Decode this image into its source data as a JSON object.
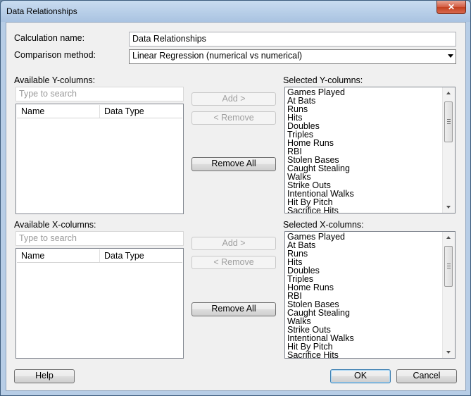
{
  "window": {
    "title": "Data Relationships",
    "close_glyph": "✕"
  },
  "calculation": {
    "label": "Calculation name:",
    "value": "Data Relationships"
  },
  "comparison": {
    "label": "Comparison method:",
    "value": "Linear Regression (numerical vs numerical)"
  },
  "y_section": {
    "available_label": "Available Y-columns:",
    "search_placeholder": "Type to search",
    "columns": [
      "Name",
      "Data Type"
    ],
    "selected_label": "Selected Y-columns:",
    "add_label": "Add >",
    "remove_label": "< Remove",
    "remove_all_label": "Remove All",
    "selected_items": [
      "Games Played",
      "At Bats",
      "Runs",
      "Hits",
      "Doubles",
      "Triples",
      "Home Runs",
      "RBI",
      "Stolen Bases",
      "Caught Stealing",
      "Walks",
      "Strike Outs",
      "Intentional Walks",
      "Hit By Pitch",
      "Sacrifice Hits"
    ]
  },
  "x_section": {
    "available_label": "Available X-columns:",
    "search_placeholder": "Type to search",
    "columns": [
      "Name",
      "Data Type"
    ],
    "selected_label": "Selected X-columns:",
    "add_label": "Add >",
    "remove_label": "< Remove",
    "remove_all_label": "Remove All",
    "selected_items": [
      "Games Played",
      "At Bats",
      "Runs",
      "Hits",
      "Doubles",
      "Triples",
      "Home Runs",
      "RBI",
      "Stolen Bases",
      "Caught Stealing",
      "Walks",
      "Strike Outs",
      "Intentional Walks",
      "Hit By Pitch",
      "Sacrifice Hits"
    ]
  },
  "footer": {
    "help_label": "Help",
    "ok_label": "OK",
    "cancel_label": "Cancel"
  }
}
